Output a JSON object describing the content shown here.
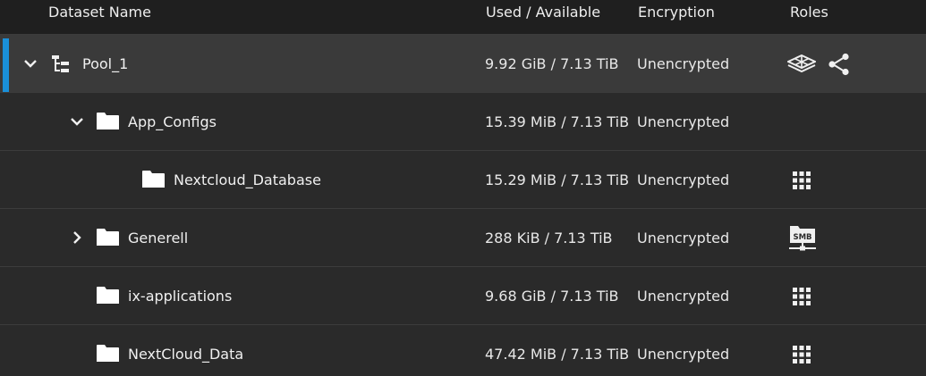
{
  "header": {
    "name": "Dataset Name",
    "used": "Used / Available",
    "encryption": "Encryption",
    "roles": "Roles"
  },
  "rows": [
    {
      "name": "Pool_1",
      "used": "9.92 GiB / 7.13 TiB",
      "encryption": "Unencrypted",
      "expanded": true,
      "selected": true,
      "roles": [
        "apps-icon",
        "share-icon"
      ]
    },
    {
      "name": "App_Configs",
      "used": "15.39 MiB / 7.13 TiB",
      "encryption": "Unencrypted",
      "expanded": true,
      "roles": []
    },
    {
      "name": "Nextcloud_Database",
      "used": "15.29 MiB / 7.13 TiB",
      "encryption": "Unencrypted",
      "roles": [
        "grid-icon"
      ]
    },
    {
      "name": "Generell",
      "used": "288 KiB / 7.13 TiB",
      "encryption": "Unencrypted",
      "expanded": false,
      "roles": [
        "smb-share-icon"
      ]
    },
    {
      "name": "ix-applications",
      "used": "9.68 GiB / 7.13 TiB",
      "encryption": "Unencrypted",
      "roles": [
        "grid-icon"
      ]
    },
    {
      "name": "NextCloud_Data",
      "used": "47.42 MiB / 7.13 TiB",
      "encryption": "Unencrypted",
      "roles": [
        "grid-icon"
      ]
    }
  ],
  "smb_label": "SMB",
  "colors": {
    "accent": "#1a90d9",
    "selected_row": "#3a3a3a",
    "background": "#2a2a2a"
  }
}
